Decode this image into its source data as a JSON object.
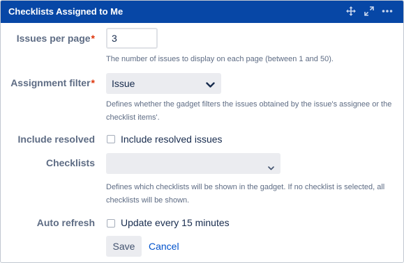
{
  "header": {
    "title": "Checklists Assigned to Me",
    "icons": [
      "move-icon",
      "expand-icon",
      "more-icon"
    ]
  },
  "fields": {
    "issues_per_page": {
      "label": "Issues per page",
      "required_marker": "*",
      "value": "3",
      "help": "The number of issues to display on each page (between 1 and 50)."
    },
    "assignment_filter": {
      "label": "Assignment filter",
      "required_marker": "*",
      "selected": "Issue",
      "help": "Defines whether the gadget filters the issues obtained by the issue's assignee or the checklist items'."
    },
    "include_resolved": {
      "label": "Include resolved",
      "checkbox_label": "Include resolved issues",
      "checked": false
    },
    "checklists": {
      "label": "Checklists",
      "selected": "",
      "help": "Defines which checklists will be shown in the gadget. If no checklist is selected, all checklists will be shown."
    },
    "auto_refresh": {
      "label": "Auto refresh",
      "checkbox_label": "Update every 15 minutes",
      "checked": false
    }
  },
  "actions": {
    "save_label": "Save",
    "cancel_label": "Cancel"
  },
  "colors": {
    "header_bg": "#0747a6",
    "label": "#5e6c84",
    "required": "#de350b",
    "link": "#0052cc",
    "field_bg": "#ebecf0"
  }
}
